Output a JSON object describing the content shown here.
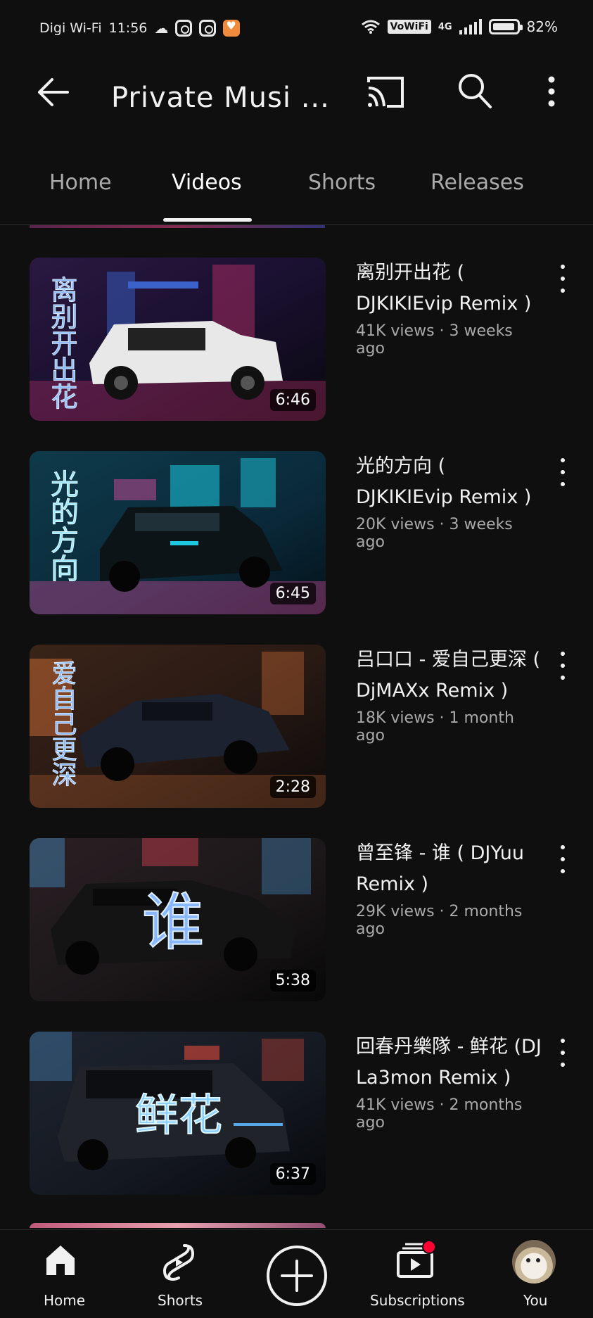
{
  "status_bar": {
    "carrier": "Digi Wi-Fi",
    "time": "11:56",
    "vowifi": "VoWiFi",
    "network": "4G",
    "battery": "82%"
  },
  "app_bar": {
    "title": "Private Musi ..."
  },
  "tabs": [
    {
      "label": "Home"
    },
    {
      "label": "Videos"
    },
    {
      "label": "Shorts"
    },
    {
      "label": "Releases"
    }
  ],
  "active_tab": "Videos",
  "videos": [
    {
      "title": "离别开出花 ( DJKIKIEvip Remix )",
      "stats": "41K views · 3 weeks ago",
      "duration": "6:46",
      "thumb_text": "离别开出花",
      "thumb_colors": [
        "#1a1030",
        "#c0306a",
        "#3a62c8"
      ]
    },
    {
      "title": "光的方向 ( DJKIKIEvip Remix )",
      "stats": "20K views · 3 weeks ago",
      "duration": "6:45",
      "thumb_text": "光的方向",
      "thumb_colors": [
        "#0a2a3a",
        "#1ec8e0",
        "#d04a9a"
      ]
    },
    {
      "title": "吕口口 - 爱自己更深 ( DjMAXx Remix )",
      "stats": "18K views · 1 month ago",
      "duration": "2:28",
      "thumb_text": "爱自己更深",
      "thumb_colors": [
        "#2a1a14",
        "#e0763a",
        "#3a5aa0"
      ]
    },
    {
      "title": "曾至锋 - 谁 ( DJYuu Remix )",
      "stats": "29K views · 2 months ago",
      "duration": "5:38",
      "thumb_text": "谁",
      "thumb_colors": [
        "#1a1618",
        "#d04050",
        "#4a9ad8"
      ]
    },
    {
      "title": "回春丹樂隊 - 鲜花 (DJ La3mon Remix )",
      "stats": "41K views · 2 months ago",
      "duration": "6:37",
      "thumb_text": "鲜花",
      "thumb_colors": [
        "#141820",
        "#e04a3a",
        "#58a8e8"
      ]
    }
  ],
  "bottom_nav": [
    {
      "label": "Home",
      "icon": "home-icon"
    },
    {
      "label": "Shorts",
      "icon": "shorts-icon"
    },
    {
      "label": "",
      "icon": "create-icon"
    },
    {
      "label": "Subscriptions",
      "icon": "subscriptions-icon"
    },
    {
      "label": "You",
      "icon": "avatar"
    }
  ],
  "colors": {
    "background": "#0f0f0f",
    "text_primary": "#f1f1f1",
    "text_secondary": "#aaaaaa",
    "notification": "#ff0033"
  }
}
